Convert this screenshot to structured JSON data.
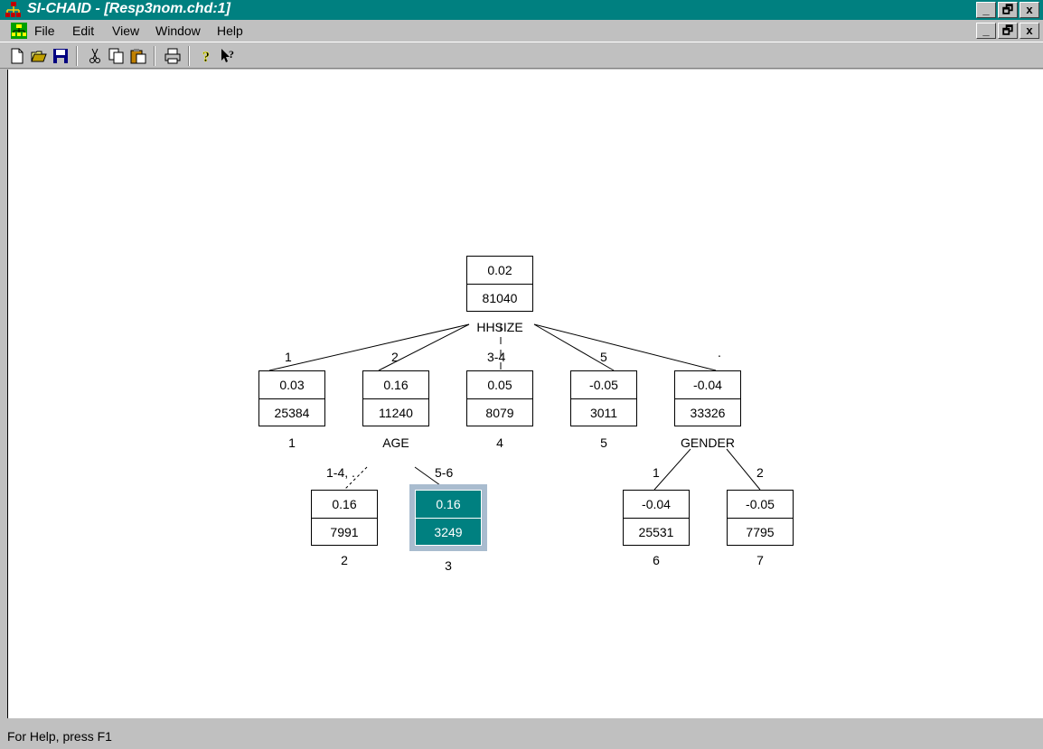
{
  "window": {
    "title": "SI-CHAID - [Resp3nom.chd:1]",
    "min_glyph": "_",
    "restore_glyph": "🗗",
    "close_glyph": "x"
  },
  "menu": {
    "file": "File",
    "edit": "Edit",
    "view": "View",
    "window": "Window",
    "help": "Help"
  },
  "status": {
    "text": "For Help, press F1"
  },
  "tree": {
    "root": {
      "value": "0.02",
      "count": "81040",
      "split": "HHSIZE"
    },
    "level1": [
      {
        "edge": "1",
        "value": "0.03",
        "count": "25384",
        "id": "1"
      },
      {
        "edge": "2",
        "value": "0.16",
        "count": "11240",
        "split": "AGE"
      },
      {
        "edge": "3-4",
        "value": "0.05",
        "count": "8079",
        "id": "4"
      },
      {
        "edge": "5",
        "value": "-0.05",
        "count": "3011",
        "id": "5"
      },
      {
        "edge": ".",
        "value": "-0.04",
        "count": "33326",
        "split": "GENDER"
      }
    ],
    "age_children": [
      {
        "edge": "1-4, .",
        "value": "0.16",
        "count": "7991",
        "id": "2"
      },
      {
        "edge": "5-6",
        "value": "0.16",
        "count": "3249",
        "id": "3",
        "selected": true
      }
    ],
    "gender_children": [
      {
        "edge": "1",
        "value": "-0.04",
        "count": "25531",
        "id": "6"
      },
      {
        "edge": "2",
        "value": "-0.05",
        "count": "7795",
        "id": "7"
      }
    ]
  },
  "colors": {
    "title_bar": "#008080",
    "selected_node": "#008080",
    "selected_frame": "#a9bccf"
  }
}
